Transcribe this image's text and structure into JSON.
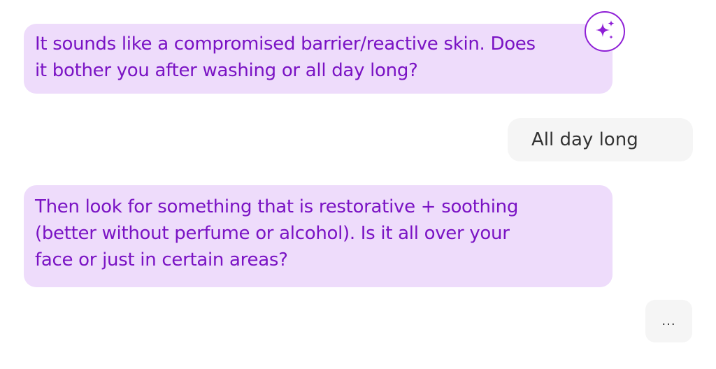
{
  "colors": {
    "assistant_bg": "#eedcfb",
    "assistant_text": "#7a13c4",
    "user_bg": "#f5f5f5",
    "user_text": "#333333",
    "accent": "#8e1fd6"
  },
  "messages": [
    {
      "role": "assistant",
      "lines": [
        "It sounds like a compromised barrier/reactive skin. Does",
        "it bother you after washing or all day long?"
      ]
    },
    {
      "role": "user",
      "text": "All day long"
    },
    {
      "role": "assistant",
      "lines": [
        "Then look for something that is restorative + soothing",
        "(better without perfume or alcohol). Is it all over your",
        "face or just in certain areas?"
      ]
    }
  ],
  "typing_indicator": "...",
  "avatar_icon": "sparkle-icon"
}
